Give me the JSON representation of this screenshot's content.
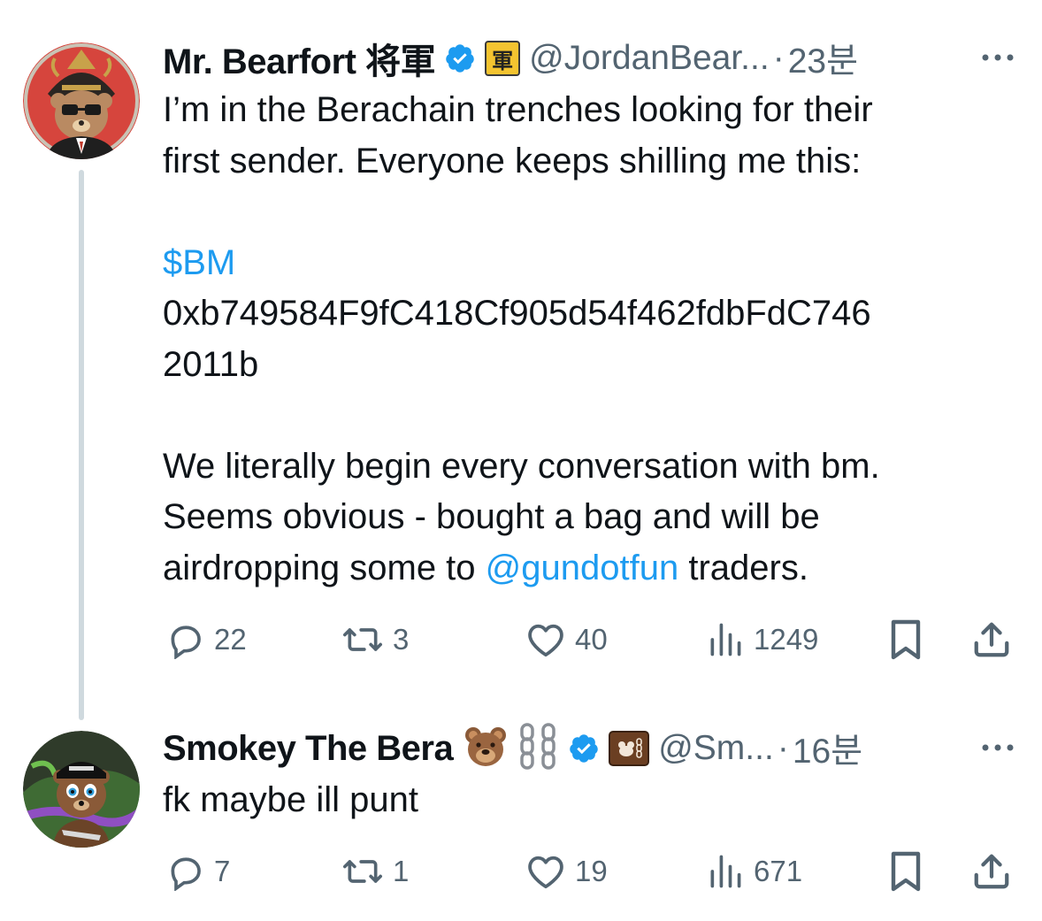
{
  "tweet1": {
    "display_name": "Mr. Bearfort 将軍",
    "affiliate_badge_char": "軍",
    "handle": "@JordanBear...",
    "separator": "·",
    "time": "23분",
    "lines": [
      "I’m in the Berachain trenches looking for their",
      "first sender. Everyone keeps shilling me this:",
      "",
      "$BM",
      "0xb749584F9fC418Cf905d54f462fdbFdC746",
      "2011b",
      "",
      "We literally begin every conversation with bm.",
      "Seems obvious - bought a bag and will be"
    ],
    "last_line_prefix": "airdropping some to ",
    "mention": "@gundotfun",
    "last_line_suffix": " traders.",
    "replies": "22",
    "retweets": "3",
    "likes": "40",
    "views": "1249"
  },
  "tweet2": {
    "display_name": "Smokey The Bera",
    "handle": "@Sm...",
    "separator": "·",
    "time": "16분",
    "text": "fk maybe ill punt",
    "replies": "7",
    "retweets": "1",
    "likes": "19",
    "views": "671"
  },
  "colors": {
    "verified": "#1d9bf0",
    "link": "#1d9bf0",
    "secondary_text": "#536471",
    "thread_line": "#cfd9de",
    "affiliate_badge_bg": "#f4c430"
  },
  "icons": [
    "verified-badge-icon",
    "reply-icon",
    "retweet-icon",
    "like-icon",
    "views-icon",
    "bookmark-icon",
    "share-icon",
    "more-icon",
    "bear-emoji",
    "chain-emoji"
  ]
}
